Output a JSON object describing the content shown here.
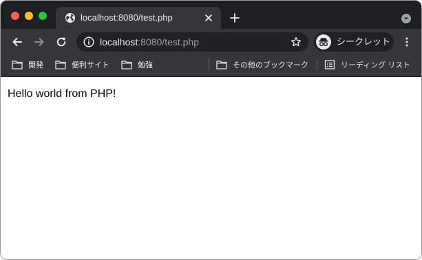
{
  "window": {
    "traffic_lights": [
      "close",
      "minimize",
      "zoom"
    ]
  },
  "tab": {
    "title": "localhost:8080/test.php",
    "icon": "globe-icon"
  },
  "toolbar": {
    "url_host": "localhost",
    "url_rest": ":8080/test.php",
    "incognito_label": "シークレット"
  },
  "bookmarks": {
    "items": [
      {
        "label": "開発",
        "icon": "folder-icon"
      },
      {
        "label": "便利サイト",
        "icon": "folder-icon"
      },
      {
        "label": "勉強",
        "icon": "folder-icon"
      },
      {
        "label": "その他のブックマーク",
        "icon": "folder-icon"
      },
      {
        "label": "リーディング リスト",
        "icon": "reading-list-icon"
      }
    ]
  },
  "page": {
    "text": "Hello world from PHP!"
  },
  "colors": {
    "tabstrip": "#1e1f22",
    "toolbar": "#35363a",
    "omnibox": "#202124",
    "text_light": "#e8eaed",
    "text_dim": "#9aa0a6"
  }
}
